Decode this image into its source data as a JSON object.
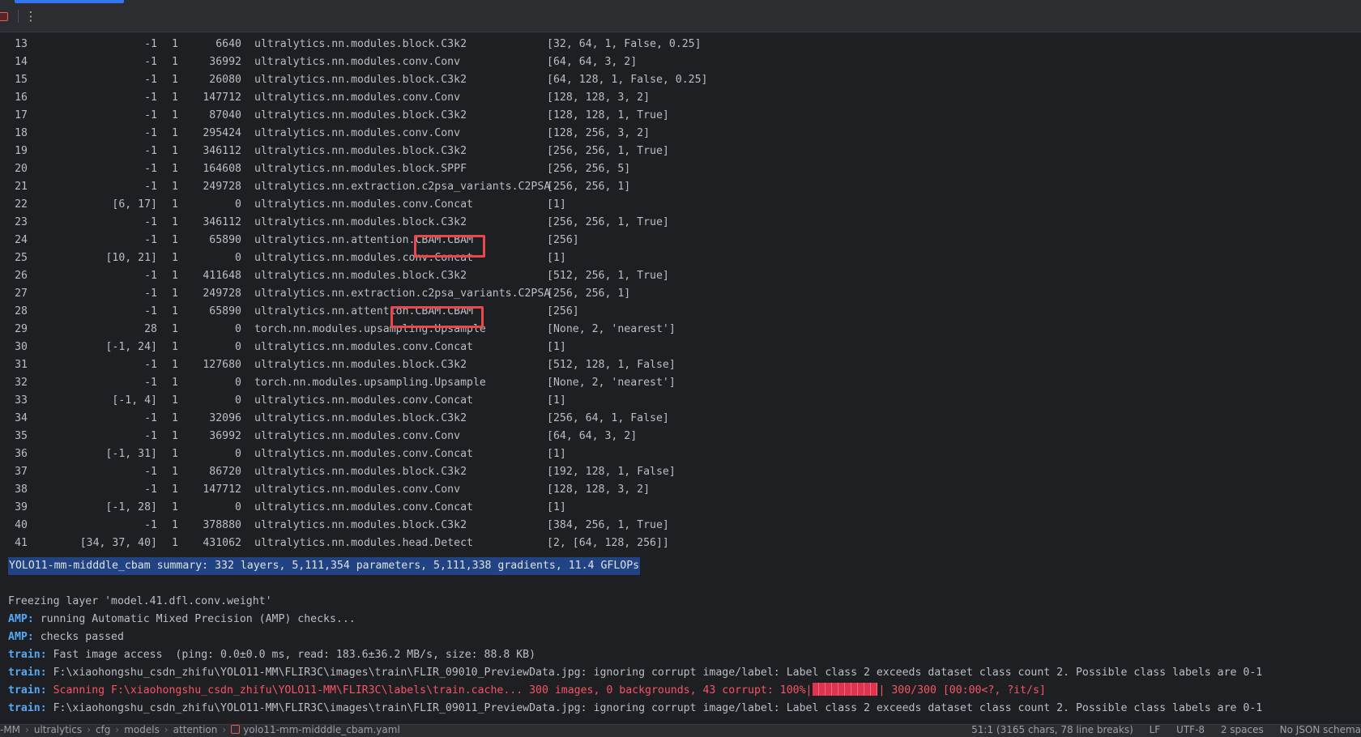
{
  "toolbar": {
    "more_label": "⋮"
  },
  "rows": [
    {
      "idx": "13",
      "from": "-1",
      "n": "1",
      "params": "6640",
      "module": "ultralytics.nn.modules.block.C3k2",
      "args": "[32, 64, 1, False, 0.25]"
    },
    {
      "idx": "14",
      "from": "-1",
      "n": "1",
      "params": "36992",
      "module": "ultralytics.nn.modules.conv.Conv",
      "args": "[64, 64, 3, 2]"
    },
    {
      "idx": "15",
      "from": "-1",
      "n": "1",
      "params": "26080",
      "module": "ultralytics.nn.modules.block.C3k2",
      "args": "[64, 128, 1, False, 0.25]"
    },
    {
      "idx": "16",
      "from": "-1",
      "n": "1",
      "params": "147712",
      "module": "ultralytics.nn.modules.conv.Conv",
      "args": "[128, 128, 3, 2]"
    },
    {
      "idx": "17",
      "from": "-1",
      "n": "1",
      "params": "87040",
      "module": "ultralytics.nn.modules.block.C3k2",
      "args": "[128, 128, 1, True]"
    },
    {
      "idx": "18",
      "from": "-1",
      "n": "1",
      "params": "295424",
      "module": "ultralytics.nn.modules.conv.Conv",
      "args": "[128, 256, 3, 2]"
    },
    {
      "idx": "19",
      "from": "-1",
      "n": "1",
      "params": "346112",
      "module": "ultralytics.nn.modules.block.C3k2",
      "args": "[256, 256, 1, True]"
    },
    {
      "idx": "20",
      "from": "-1",
      "n": "1",
      "params": "164608",
      "module": "ultralytics.nn.modules.block.SPPF",
      "args": "[256, 256, 5]"
    },
    {
      "idx": "21",
      "from": "-1",
      "n": "1",
      "params": "249728",
      "module": "ultralytics.nn.extraction.c2psa_variants.C2PSA",
      "args": "[256, 256, 1]"
    },
    {
      "idx": "22",
      "from": "[6, 17]",
      "n": "1",
      "params": "0",
      "module": "ultralytics.nn.modules.conv.Concat",
      "args": "[1]"
    },
    {
      "idx": "23",
      "from": "-1",
      "n": "1",
      "params": "346112",
      "module": "ultralytics.nn.modules.block.C3k2",
      "args": "[256, 256, 1, True]"
    },
    {
      "idx": "24",
      "from": "-1",
      "n": "1",
      "params": "65890",
      "module": "ultralytics.nn.attention.CBAM.CBAM",
      "args": "[256]"
    },
    {
      "idx": "25",
      "from": "[10, 21]",
      "n": "1",
      "params": "0",
      "module": "ultralytics.nn.modules.conv.Concat",
      "args": "[1]"
    },
    {
      "idx": "26",
      "from": "-1",
      "n": "1",
      "params": "411648",
      "module": "ultralytics.nn.modules.block.C3k2",
      "args": "[512, 256, 1, True]"
    },
    {
      "idx": "27",
      "from": "-1",
      "n": "1",
      "params": "249728",
      "module": "ultralytics.nn.extraction.c2psa_variants.C2PSA",
      "args": "[256, 256, 1]"
    },
    {
      "idx": "28",
      "from": "-1",
      "n": "1",
      "params": "65890",
      "module": "ultralytics.nn.attention.CBAM.CBAM",
      "args": "[256]"
    },
    {
      "idx": "29",
      "from": "28",
      "n": "1",
      "params": "0",
      "module": "torch.nn.modules.upsampling.Upsample",
      "args": "[None, 2, 'nearest']"
    },
    {
      "idx": "30",
      "from": "[-1, 24]",
      "n": "1",
      "params": "0",
      "module": "ultralytics.nn.modules.conv.Concat",
      "args": "[1]"
    },
    {
      "idx": "31",
      "from": "-1",
      "n": "1",
      "params": "127680",
      "module": "ultralytics.nn.modules.block.C3k2",
      "args": "[512, 128, 1, False]"
    },
    {
      "idx": "32",
      "from": "-1",
      "n": "1",
      "params": "0",
      "module": "torch.nn.modules.upsampling.Upsample",
      "args": "[None, 2, 'nearest']"
    },
    {
      "idx": "33",
      "from": "[-1, 4]",
      "n": "1",
      "params": "0",
      "module": "ultralytics.nn.modules.conv.Concat",
      "args": "[1]"
    },
    {
      "idx": "34",
      "from": "-1",
      "n": "1",
      "params": "32096",
      "module": "ultralytics.nn.modules.block.C3k2",
      "args": "[256, 64, 1, False]"
    },
    {
      "idx": "35",
      "from": "-1",
      "n": "1",
      "params": "36992",
      "module": "ultralytics.nn.modules.conv.Conv",
      "args": "[64, 64, 3, 2]"
    },
    {
      "idx": "36",
      "from": "[-1, 31]",
      "n": "1",
      "params": "0",
      "module": "ultralytics.nn.modules.conv.Concat",
      "args": "[1]"
    },
    {
      "idx": "37",
      "from": "-1",
      "n": "1",
      "params": "86720",
      "module": "ultralytics.nn.modules.block.C3k2",
      "args": "[192, 128, 1, False]"
    },
    {
      "idx": "38",
      "from": "-1",
      "n": "1",
      "params": "147712",
      "module": "ultralytics.nn.modules.conv.Conv",
      "args": "[128, 128, 3, 2]"
    },
    {
      "idx": "39",
      "from": "[-1, 28]",
      "n": "1",
      "params": "0",
      "module": "ultralytics.nn.modules.conv.Concat",
      "args": "[1]"
    },
    {
      "idx": "40",
      "from": "-1",
      "n": "1",
      "params": "378880",
      "module": "ultralytics.nn.modules.block.C3k2",
      "args": "[384, 256, 1, True]"
    },
    {
      "idx": "41",
      "from": "[34, 37, 40]",
      "n": "1",
      "params": "431062",
      "module": "ultralytics.nn.modules.head.Detect",
      "args": "[2, [64, 128, 256]]"
    }
  ],
  "summary": "YOLO11-mm-midddle_cbam summary: 332 layers, 5,111,354 parameters, 5,111,338 gradients, 11.4 GFLOPs",
  "log": {
    "freeze": "Freezing layer 'model.41.dfl.conv.weight'",
    "amp1_tag": "AMP:",
    "amp1_text": " running Automatic Mixed Precision (AMP) checks...",
    "amp2_tag": "AMP:",
    "amp2_text": " checks passed",
    "train1_tag": "train:",
    "train1_text": " Fast image access  (ping: 0.0±0.0 ms, read: 183.6±36.2 MB/s, size: 88.8 KB)",
    "train2_tag": "train:",
    "train2_text": " F:\\xiaohongshu_csdn_zhifu\\YOLO11-MM\\FLIR3C\\images\\train\\FLIR_09010_PreviewData.jpg: ignoring corrupt image/label: Label class 2 exceeds dataset class count 2. Possible class labels are 0-1",
    "train3_tag": "train:",
    "train3_text_a": " Scanning F:\\xiaohongshu_csdn_zhifu\\YOLO11-MM\\FLIR3C\\labels\\train.cache... 300 images, 0 backgrounds, 43 corrupt: 100%|",
    "train3_progress": 1.0,
    "train3_text_b": "| 300/300 [00:00<?, ?it/s]",
    "train4_tag": "train:",
    "train4_text": " F:\\xiaohongshu_csdn_zhifu\\YOLO11-MM\\FLIR3C\\images\\train\\FLIR_09011_PreviewData.jpg: ignoring corrupt image/label: Label class 2 exceeds dataset class count 2. Possible class labels are 0-1"
  },
  "statusbar": {
    "crumbs": [
      "-MM",
      "ultralytics",
      "cfg",
      "models",
      "attention"
    ],
    "file": "yolo11-mm-midddle_cbam.yaml",
    "position": "51:1 (3165 chars, 78 line breaks)",
    "line_sep": "LF",
    "encoding": "UTF-8",
    "indent": "2 spaces",
    "schema": "No JSON schema"
  },
  "colors": {
    "tag": "#56a8f5",
    "error": "#f75464",
    "highlight_box": "#e8484c",
    "selection": "#214283"
  }
}
